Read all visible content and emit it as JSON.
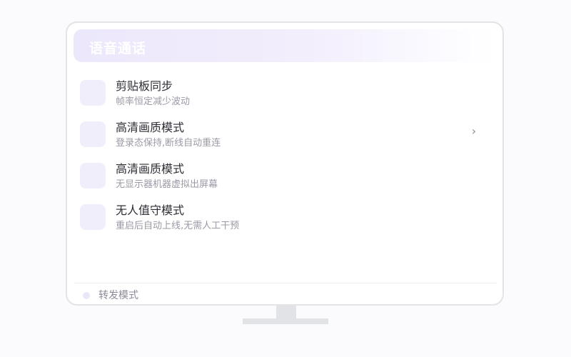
{
  "header": {
    "title": "语音通话"
  },
  "items": [
    {
      "title": "剪贴板同步",
      "subtitle": "帧率恒定减少波动",
      "has_chevron": false
    },
    {
      "title": "高清画质模式",
      "subtitle": "登录态保持,断线自动重连",
      "has_chevron": true
    },
    {
      "title": "高清画质模式",
      "subtitle": "无显示器机器虚拟出屏幕",
      "has_chevron": false
    },
    {
      "title": "无人值守模式",
      "subtitle": "重启后自动上线,无需人工干预",
      "has_chevron": false
    }
  ],
  "chevron_glyph": "›",
  "footer": {
    "label": "转发模式"
  },
  "colors": {
    "accent_light": "#f1eefb",
    "header_gradient_start": "#ece7fb",
    "title_text": "#2c2c34",
    "subtitle_text": "#9a9aa6",
    "stand": "#e1e3e7"
  }
}
